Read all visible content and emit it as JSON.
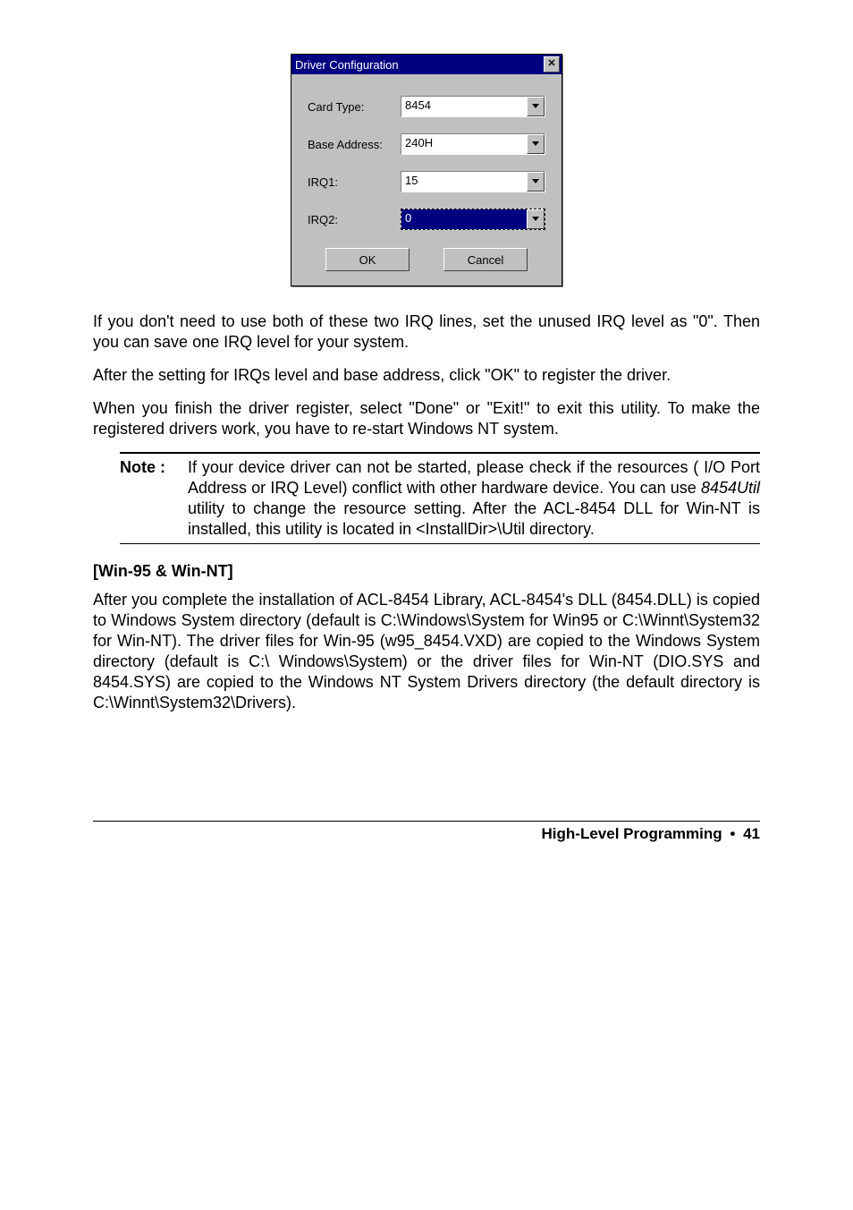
{
  "dialog": {
    "title": "Driver Configuration",
    "close_glyph": "✕",
    "fields": {
      "card_type": {
        "label": "Card Type:",
        "value": "8454"
      },
      "base_address": {
        "label": "Base Address:",
        "value": "240H"
      },
      "irq1": {
        "label": "IRQ1:",
        "value": "15"
      },
      "irq2": {
        "label": "IRQ2:",
        "value": "0"
      }
    },
    "ok_label": "OK",
    "cancel_label": "Cancel"
  },
  "paragraphs": {
    "p1": "If you don't need to use both of these two IRQ lines, set the unused IRQ level as \"0\". Then you can save one IRQ level for your system.",
    "p2": "After the setting for IRQs level and base address, click \"OK\" to register the driver.",
    "p3": "When you finish the driver register, select \"Done\" or \"Exit!\" to exit this utility. To make the registered drivers work, you have to re-start Windows NT system."
  },
  "note": {
    "label": "Note :",
    "text_before_util": "If your device driver can not be started, please check if the resources ( I/O Port Address or IRQ Level) conflict with other hardware device. You can use ",
    "util_name": "8454Util",
    "text_after_util": " utility to change the resource setting. After the ACL-8454 DLL for Win-NT is installed, this utility is located in <InstallDir>\\Util directory."
  },
  "subhead": "[Win-95 & Win-NT]",
  "p4": "After you complete the installation of ACL-8454 Library, ACL-8454's DLL (8454.DLL) is copied to Windows System directory (default is C:\\Windows\\System for Win95 or C:\\Winnt\\System32 for Win-NT). The driver files for Win-95 (w95_8454.VXD) are copied to the Windows System directory (default is C:\\ Windows\\System) or the driver files for Win-NT (DIO.SYS and 8454.SYS) are copied to the Windows NT System Drivers directory (the default directory is C:\\Winnt\\System32\\Drivers).",
  "footer": {
    "section": "High-Level Programming",
    "bullet": "•",
    "page": "41"
  }
}
